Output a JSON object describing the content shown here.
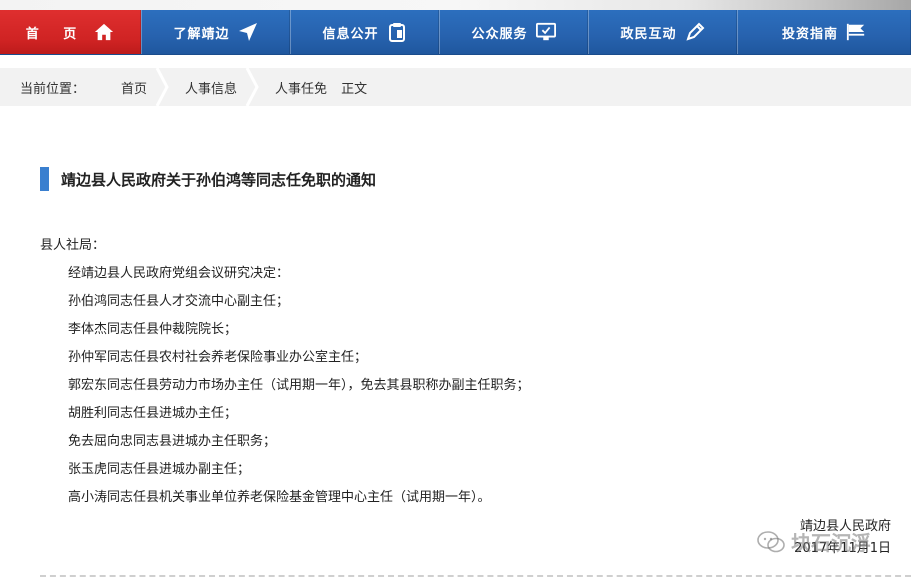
{
  "nav": {
    "items": [
      {
        "label": "首 页",
        "icon": "home-icon"
      },
      {
        "label": "了解靖边",
        "icon": "send-arrow-icon"
      },
      {
        "label": "信息公开",
        "icon": "clipboard-icon"
      },
      {
        "label": "公众服务",
        "icon": "monitor-check-icon"
      },
      {
        "label": "政民互动",
        "icon": "pen-icon"
      },
      {
        "label": "投资指南",
        "icon": "flag-icon"
      }
    ]
  },
  "breadcrumb": {
    "lead": "当前位置：",
    "items": [
      "首页",
      "人事信息",
      "人事任免"
    ],
    "current": "正文"
  },
  "article": {
    "title": "靖边县人民政府关于孙伯鸿等同志任免职的通知",
    "salutation": "县人社局：",
    "lines": [
      "经靖边县人民政府党组会议研究决定：",
      "孙伯鸿同志任县人才交流中心副主任；",
      "李体杰同志任县仲裁院院长；",
      "孙仲军同志任县农村社会养老保险事业办公室主任；",
      "郭宏东同志任县劳动力市场办主任（试用期一年），免去其县职称办副主任职务；",
      "胡胜利同志任县进城办主任；",
      "免去屈向忠同志县进城办主任职务；",
      "张玉虎同志任县进城办副主任；",
      "高小涛同志任县机关事业单位养老保险基金管理中心主任（试用期一年）。"
    ],
    "signer": "靖边县人民政府",
    "date": "2017年11月1日"
  },
  "watermark": {
    "text": "块石沉浮",
    "icon": "wechat-icon"
  },
  "colors": {
    "nav_blue": "#2762ae",
    "home_red": "#cf2323",
    "title_accent": "#3a7fcf",
    "crumb_bg": "#f2f2f2"
  }
}
